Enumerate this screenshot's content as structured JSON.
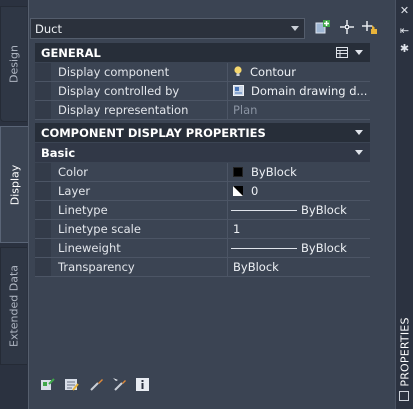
{
  "tabs": {
    "design": "Design",
    "display": "Display",
    "extended_data": "Extended Data"
  },
  "header": {
    "object_type": "Duct"
  },
  "general": {
    "title": "GENERAL",
    "rows": [
      {
        "label": "Display component",
        "value": "Contour"
      },
      {
        "label": "Display controlled by",
        "value": "Domain drawing d..."
      },
      {
        "label": "Display representation",
        "value": "Plan"
      }
    ]
  },
  "component_props": {
    "title": "COMPONENT DISPLAY PROPERTIES",
    "sub_title": "Basic",
    "rows": [
      {
        "label": "Color",
        "value": "ByBlock"
      },
      {
        "label": "Layer",
        "value": "0"
      },
      {
        "label": "Linetype",
        "value": "ByBlock"
      },
      {
        "label": "Linetype scale",
        "value": "1"
      },
      {
        "label": "Lineweight",
        "value": "ByBlock"
      },
      {
        "label": "Transparency",
        "value": "ByBlock"
      }
    ]
  },
  "palette": {
    "title": "PROPERTIES"
  },
  "icons": [
    "add-selected-icon",
    "select-objects-icon",
    "quick-select-icon",
    "close-icon",
    "autohide-icon",
    "settings-icon",
    "help-info-icon"
  ],
  "colors": {
    "accent_yellow": "#f5d76e",
    "background": "#3b4453",
    "header": "#272e39"
  }
}
